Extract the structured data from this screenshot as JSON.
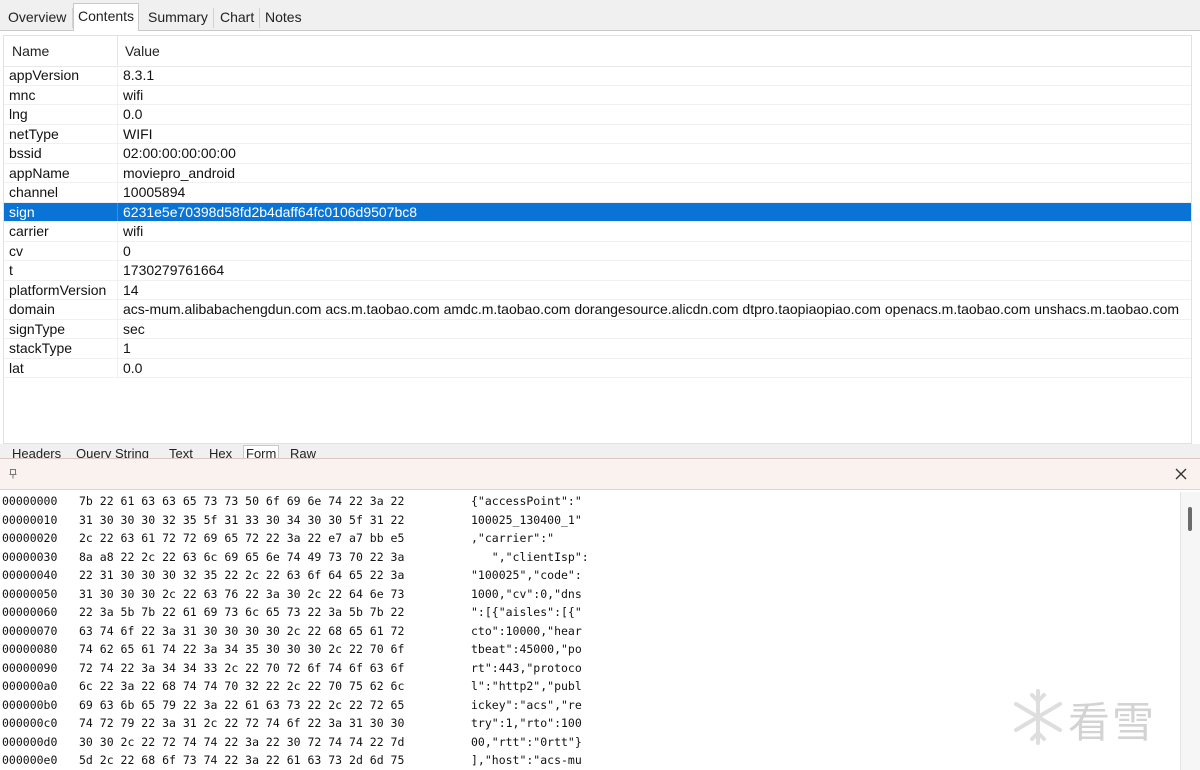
{
  "top_tabs": [
    "Overview",
    "Contents",
    "Summary",
    "Chart",
    "Notes"
  ],
  "active_top_tab": "Contents",
  "grid": {
    "col_name": "Name",
    "col_value": "Value",
    "rows": [
      {
        "name": "appVersion",
        "value": "8.3.1"
      },
      {
        "name": "mnc",
        "value": "wifi"
      },
      {
        "name": "lng",
        "value": "0.0"
      },
      {
        "name": "netType",
        "value": "WIFI"
      },
      {
        "name": "bssid",
        "value": "02:00:00:00:00:00"
      },
      {
        "name": "appName",
        "value": "moviepro_android"
      },
      {
        "name": "channel",
        "value": "10005894"
      },
      {
        "name": "sign",
        "value": "6231e5e70398d58fd2b4daff64fc0106d9507bc8"
      },
      {
        "name": "carrier",
        "value": "wifi"
      },
      {
        "name": "cv",
        "value": "0"
      },
      {
        "name": "t",
        "value": "1730279761664"
      },
      {
        "name": "platformVersion",
        "value": "14"
      },
      {
        "name": "domain",
        "value": "acs-mum.alibabachengdun.com acs.m.taobao.com amdc.m.taobao.com dorangesource.alicdn.com dtpro.taopiaopiao.com openacs.m.taobao.com unshacs.m.taobao.com"
      },
      {
        "name": "signType",
        "value": "sec"
      },
      {
        "name": "stackType",
        "value": "1"
      },
      {
        "name": "lat",
        "value": "0.0"
      }
    ],
    "selected_row": "sign"
  },
  "bottom_tabs": [
    "Headers",
    "Query String",
    "Text",
    "Hex",
    "Form",
    "Raw"
  ],
  "active_bottom_tab": "Form",
  "hex": {
    "rows": [
      {
        "offset": "00000000",
        "bytes": "7b 22 61 63 63 65 73 73 50 6f 69 6e 74 22 3a 22",
        "ascii": "{\"accessPoint\":\""
      },
      {
        "offset": "00000010",
        "bytes": "31 30 30 30 32 35 5f 31 33 30 34 30 30 5f 31 22",
        "ascii": "100025_130400_1\""
      },
      {
        "offset": "00000020",
        "bytes": "2c 22 63 61 72 72 69 65 72 22 3a 22 e7 a7 bb e5",
        "ascii": ",\"carrier\":\""
      },
      {
        "offset": "00000030",
        "bytes": "8a a8 22 2c 22 63 6c 69 65 6e 74 49 73 70 22 3a",
        "ascii": "   \",\"clientIsp\":"
      },
      {
        "offset": "00000040",
        "bytes": "22 31 30 30 30 32 35 22 2c 22 63 6f 64 65 22 3a",
        "ascii": "\"100025\",\"code\":"
      },
      {
        "offset": "00000050",
        "bytes": "31 30 30 30 2c 22 63 76 22 3a 30 2c 22 64 6e 73",
        "ascii": "1000,\"cv\":0,\"dns"
      },
      {
        "offset": "00000060",
        "bytes": "22 3a 5b 7b 22 61 69 73 6c 65 73 22 3a 5b 7b 22",
        "ascii": "\":[{\"aisles\":[{\""
      },
      {
        "offset": "00000070",
        "bytes": "63 74 6f 22 3a 31 30 30 30 30 2c 22 68 65 61 72",
        "ascii": "cto\":10000,\"hear"
      },
      {
        "offset": "00000080",
        "bytes": "74 62 65 61 74 22 3a 34 35 30 30 30 2c 22 70 6f",
        "ascii": "tbeat\":45000,\"po"
      },
      {
        "offset": "00000090",
        "bytes": "72 74 22 3a 34 34 33 2c 22 70 72 6f 74 6f 63 6f",
        "ascii": "rt\":443,\"protoco"
      },
      {
        "offset": "000000a0",
        "bytes": "6c 22 3a 22 68 74 74 70 32 22 2c 22 70 75 62 6c",
        "ascii": "l\":\"http2\",\"publ"
      },
      {
        "offset": "000000b0",
        "bytes": "69 63 6b 65 79 22 3a 22 61 63 73 22 2c 22 72 65",
        "ascii": "ickey\":\"acs\",\"re"
      },
      {
        "offset": "000000c0",
        "bytes": "74 72 79 22 3a 31 2c 22 72 74 6f 22 3a 31 30 30",
        "ascii": "try\":1,\"rto\":100"
      },
      {
        "offset": "000000d0",
        "bytes": "30 30 2c 22 72 74 74 22 3a 22 30 72 74 74 22 7d",
        "ascii": "00,\"rtt\":\"0rtt\"}"
      },
      {
        "offset": "000000e0",
        "bytes": "5d 2c 22 68 6f 73 74 22 3a 22 61 63 73 2d 6d 75",
        "ascii": "],\"host\":\"acs-mu"
      }
    ]
  },
  "watermark_text": "看雪",
  "colors": {
    "selection": "#0a74d6",
    "tabbar": "#f0f0f0",
    "popup_title": "#faf2ef"
  }
}
